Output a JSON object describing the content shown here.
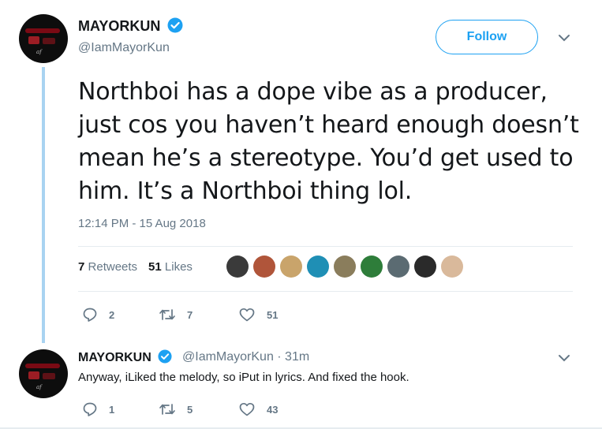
{
  "main_tweet": {
    "name": "MAYORKUN",
    "handle": "@IamMayorKun",
    "follow_label": "Follow",
    "text": "Northboi has a dope vibe as a producer, just cos you haven’t heard enough doesn’t mean he’s a stereotype. You’d get used to him. It’s a Northboi thing lol.",
    "timestamp": "12:14 PM - 15 Aug 2018",
    "retweets_count": "7",
    "retweets_label": "Retweets",
    "likes_count": "51",
    "likes_label": "Likes",
    "actions": {
      "replies": "2",
      "retweets": "7",
      "likes": "51"
    }
  },
  "liker_avatar_colors": [
    "#3a3a3a",
    "#b0553a",
    "#c9a46b",
    "#1f8fb5",
    "#8a7d5c",
    "#2e7d3a",
    "#5b6b72",
    "#2a2a2a",
    "#d9b99b"
  ],
  "reply_tweet": {
    "name": "MAYORKUN",
    "handle_time": "@IamMayorKun · 31m",
    "text": "Anyway, iLiked the melody, so iPut in lyrics. And fixed the hook.",
    "actions": {
      "replies": "1",
      "retweets": "5",
      "likes": "43"
    }
  },
  "colors": {
    "accent": "#1da1f2",
    "thread_line": "#a9d3f1",
    "muted": "#657786"
  }
}
